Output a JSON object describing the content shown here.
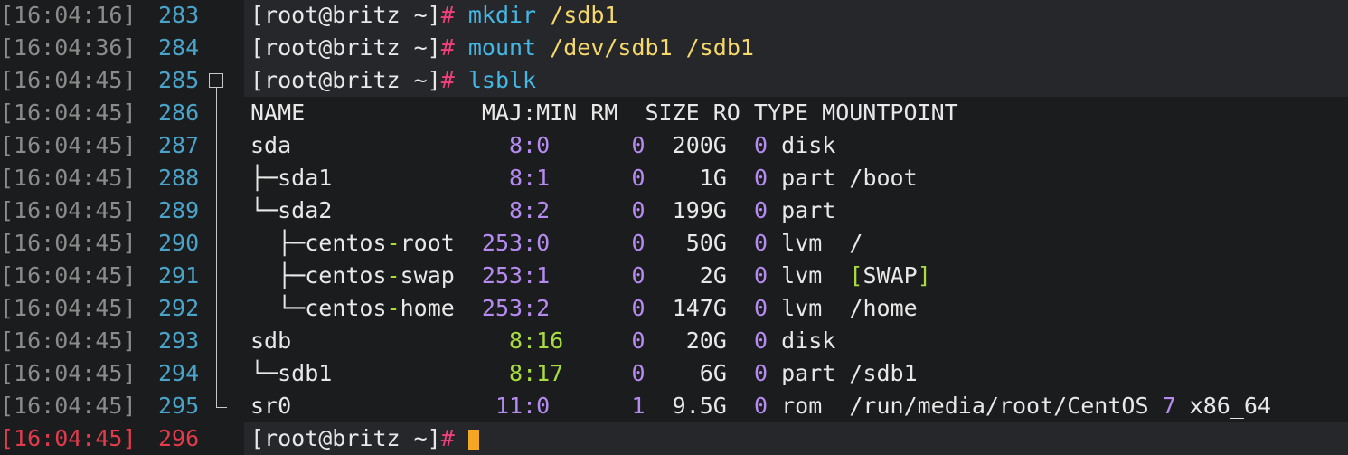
{
  "prompt": "[root@britz ~]",
  "prompt_sign": "#",
  "lines": [
    {
      "ts": "[16:04:16]",
      "ln": "283"
    },
    {
      "ts": "[16:04:36]",
      "ln": "284"
    },
    {
      "ts": "[16:04:45]",
      "ln": "285"
    },
    {
      "ts": "[16:04:45]",
      "ln": "286"
    },
    {
      "ts": "[16:04:45]",
      "ln": "287"
    },
    {
      "ts": "[16:04:45]",
      "ln": "288"
    },
    {
      "ts": "[16:04:45]",
      "ln": "289"
    },
    {
      "ts": "[16:04:45]",
      "ln": "290"
    },
    {
      "ts": "[16:04:45]",
      "ln": "291"
    },
    {
      "ts": "[16:04:45]",
      "ln": "292"
    },
    {
      "ts": "[16:04:45]",
      "ln": "293"
    },
    {
      "ts": "[16:04:45]",
      "ln": "294"
    },
    {
      "ts": "[16:04:45]",
      "ln": "295"
    },
    {
      "ts": "[16:04:45]",
      "ln": "296"
    }
  ],
  "cmd283": {
    "cmd": "mkdir",
    "arg": "/sdb1"
  },
  "cmd284": {
    "cmd": "mount",
    "arg": "/dev/sdb1 /sdb1"
  },
  "cmd285": {
    "cmd": "lsblk"
  },
  "header": "NAME             MAJ:MIN RM  SIZE RO TYPE MOUNTPOINT",
  "rows": [
    {
      "tree": "",
      "name": "sda",
      "namep": "",
      "major": "8",
      "minor": "0",
      "majcls": "num",
      "pre": "  ",
      "rm": "0",
      "size": "200G",
      "ro": "0",
      "type": "disk",
      "mount": ""
    },
    {
      "tree": "├─",
      "name": "sda1",
      "namep": "",
      "major": "8",
      "minor": "1",
      "majcls": "num",
      "pre": "  ",
      "rm": "0",
      "size": "  1G",
      "ro": "0",
      "type": "part",
      "mount": "/boot"
    },
    {
      "tree": "└─",
      "name": "sda2",
      "namep": "",
      "major": "8",
      "minor": "2",
      "majcls": "num",
      "pre": "  ",
      "rm": "0",
      "size": "199G",
      "ro": "0",
      "type": "part",
      "mount": ""
    },
    {
      "tree": "  ├─",
      "name": "centos",
      "namep": "root",
      "major": "253",
      "minor": "0",
      "majcls": "num",
      "pre": "",
      "rm": "0",
      "size": " 50G",
      "ro": "0",
      "type": "lvm ",
      "mount": "/"
    },
    {
      "tree": "  ├─",
      "name": "centos",
      "namep": "swap",
      "major": "253",
      "minor": "1",
      "majcls": "num",
      "pre": "",
      "rm": "0",
      "size": "  2G",
      "ro": "0",
      "type": "lvm ",
      "mount": "[SWAP]"
    },
    {
      "tree": "  └─",
      "name": "centos",
      "namep": "home",
      "major": "253",
      "minor": "2",
      "majcls": "num",
      "pre": "",
      "rm": "0",
      "size": "147G",
      "ro": "0",
      "type": "lvm ",
      "mount": "/home"
    },
    {
      "tree": "",
      "name": "sdb",
      "namep": "",
      "major": "8",
      "minor": "16",
      "majcls": "numg",
      "pre": "  ",
      "rm": "0",
      "size": " 20G",
      "ro": "0",
      "type": "disk",
      "mount": ""
    },
    {
      "tree": "└─",
      "name": "sdb1",
      "namep": "",
      "major": "8",
      "minor": "17",
      "majcls": "numg",
      "pre": "  ",
      "rm": "0",
      "size": "  6G",
      "ro": "0",
      "type": "part",
      "mount": "/sdb1"
    },
    {
      "tree": "",
      "name": "sr0",
      "namep": "",
      "major": "11",
      "minor": "0",
      "majcls": "num",
      "pre": " ",
      "rm": "1",
      "size": "9.5G",
      "ro": "0",
      "type": "rom ",
      "mount": "/run/media/root/CentOS 7 x86_64"
    }
  ],
  "colors": {
    "background": "#1b1c1e",
    "prompt_sign": "#f0407a",
    "command": "#44b8e4",
    "argument": "#f6d86a",
    "number": "#b58bf0",
    "green": "#a9dd3f",
    "line_number": "#4aa3c9",
    "timestamp": "#8b8b8b",
    "cursor": "#f5a623"
  }
}
